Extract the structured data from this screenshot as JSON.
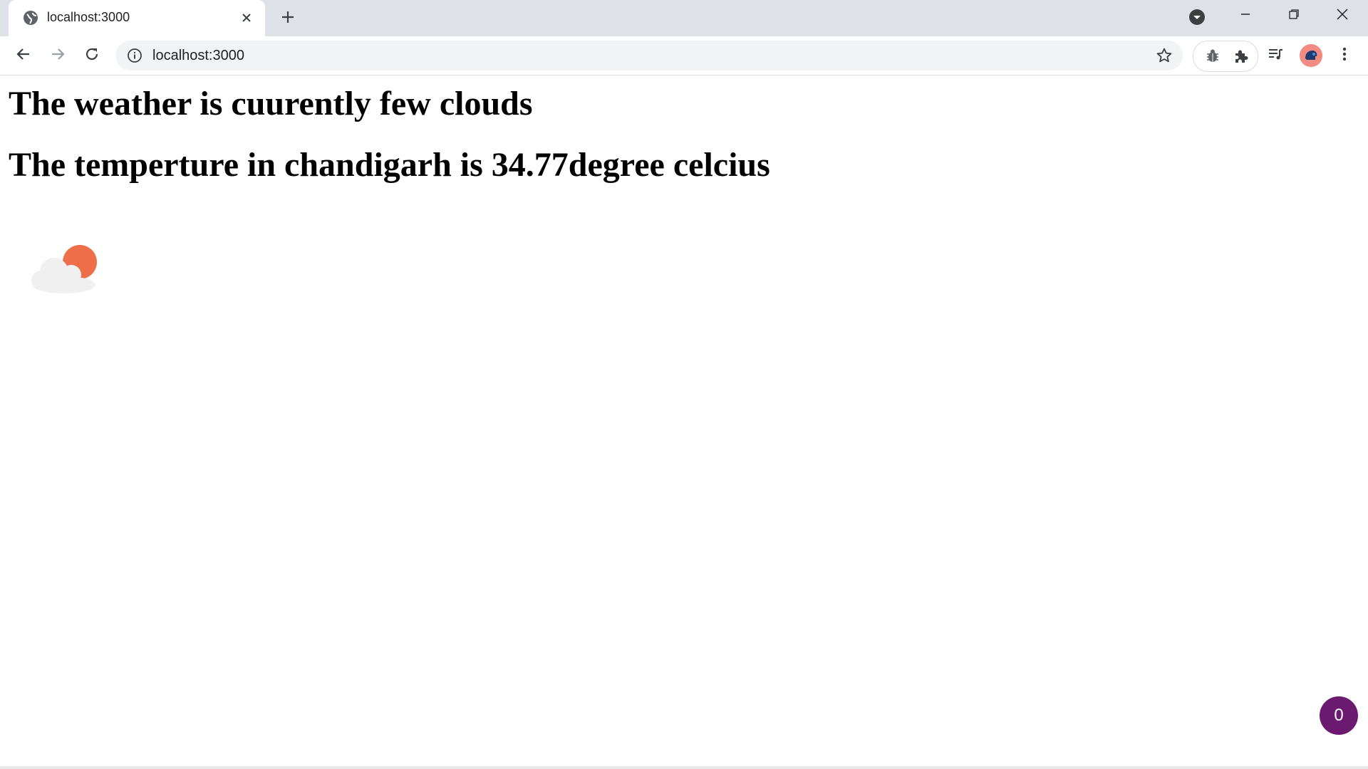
{
  "browser": {
    "tab": {
      "title": "localhost:3000"
    },
    "address_bar": {
      "url": "localhost:3000"
    },
    "icons": {
      "favicon": "globe-icon",
      "close": "close-icon",
      "new_tab": "plus-icon",
      "tab_search": "chevron-down-circle-icon",
      "back": "arrow-left-icon",
      "forward": "arrow-right-icon",
      "reload": "reload-icon",
      "site_info": "info-icon",
      "bookmark": "star-icon",
      "debugger": "bug-icon",
      "extensions": "puzzle-icon",
      "media": "playlist-icon",
      "menu": "kebab-icon"
    }
  },
  "page": {
    "weather_heading": "The weather is cuurently few clouds",
    "temperature_heading": "The temperture in chandigarh is 34.77degree celcius",
    "weather_icon": "few-clouds-icon",
    "badge_count": "0"
  },
  "colors": {
    "badge": "#6b1a70",
    "sun": "#ee6e4a",
    "cloud": "#f0f0f0",
    "avatar": "#f28b82"
  }
}
